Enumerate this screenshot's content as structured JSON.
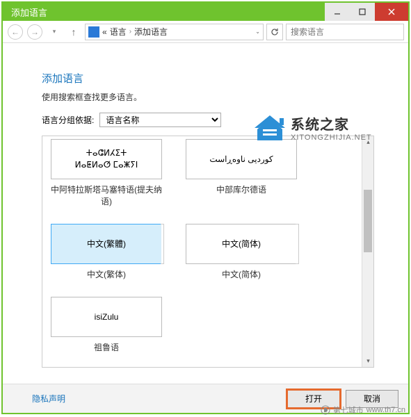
{
  "titlebar": {
    "title": "添加语言"
  },
  "nav": {
    "breadcrumb": {
      "prefix": "«",
      "part1": "语言",
      "part2": "添加语言"
    },
    "search_placeholder": "搜索语言"
  },
  "page": {
    "title": "添加语言",
    "hint": "使用搜索框查找更多语言。",
    "group_label": "语言分组依据:",
    "group_value": "语言名称"
  },
  "languages": [
    {
      "tile_line1": "ⵜⴰⵛⵍⵃⵉⵜ",
      "tile_line2": "ⵍⴰⵟⵍⴰⵚ ⵎⴰⵥⵢⵏ",
      "caption": "中阿特拉斯塔马塞特语(提夫纳语)",
      "stack": false,
      "selected": false
    },
    {
      "tile_line1": "کوردیی ناوەڕاست",
      "tile_line2": "",
      "caption": "中部库尔德语",
      "stack": false,
      "selected": false
    },
    {
      "tile_line1": "中文(繁體)",
      "tile_line2": "",
      "caption": "中文(繁体)",
      "stack": true,
      "selected": true
    },
    {
      "tile_line1": "中文(简体)",
      "tile_line2": "",
      "caption": "中文(简体)",
      "stack": true,
      "selected": false
    },
    {
      "tile_line1": "isiZulu",
      "tile_line2": "",
      "caption": "祖鲁语",
      "stack": false,
      "selected": false
    }
  ],
  "footer": {
    "privacy": "隐私声明",
    "open": "打开",
    "cancel": "取消"
  },
  "watermark": {
    "line1": "系统之家",
    "line2": "XITONGZHIJIA.NET",
    "site": "第七城市",
    "url": "www.th7.cn"
  }
}
